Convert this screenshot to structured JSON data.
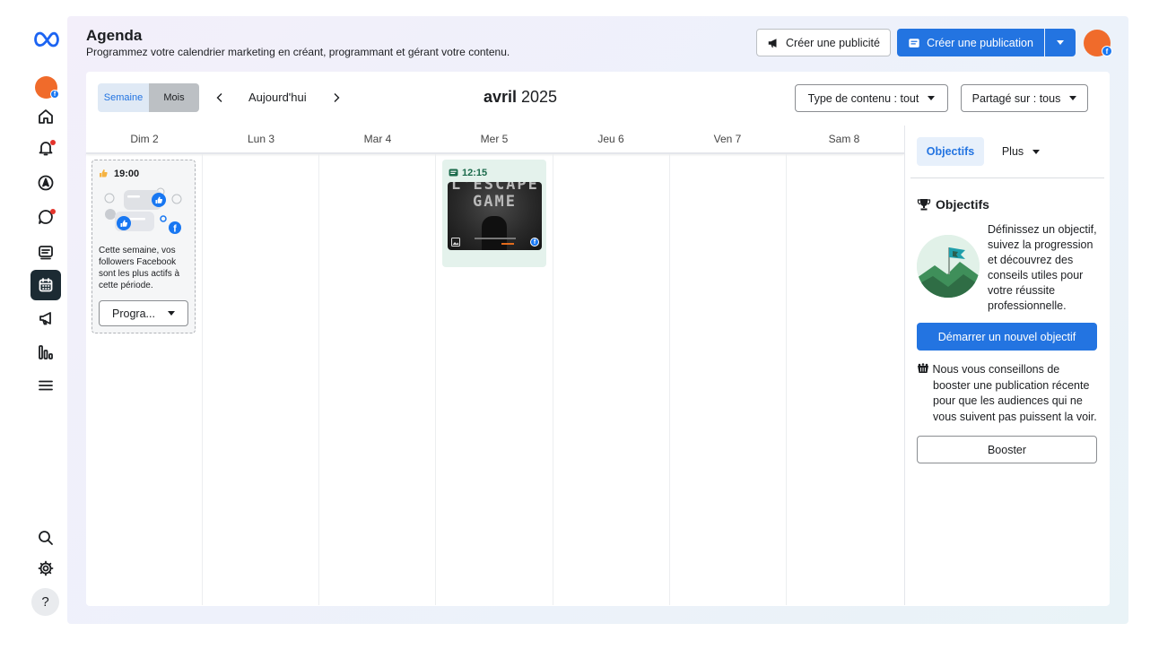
{
  "header": {
    "title": "Agenda",
    "subtitle": "Programmez votre calendrier marketing en créant, programmant et gérant votre contenu.",
    "create_ad": "Créer une publicité",
    "create_post": "Créer une publication"
  },
  "sidebar": {
    "items": [
      {
        "name": "home",
        "icon": "home-icon"
      },
      {
        "name": "notifications",
        "icon": "bell-icon"
      },
      {
        "name": "compass",
        "icon": "compass-icon"
      },
      {
        "name": "messages",
        "icon": "chat-bubble-icon"
      },
      {
        "name": "content",
        "icon": "content-icon"
      },
      {
        "name": "planner",
        "icon": "calendar-icon",
        "active": true
      },
      {
        "name": "ads",
        "icon": "megaphone-icon"
      },
      {
        "name": "insights",
        "icon": "bar-chart-icon"
      },
      {
        "name": "menu",
        "icon": "hamburger-icon"
      },
      {
        "name": "search",
        "icon": "search-icon"
      },
      {
        "name": "settings",
        "icon": "gear-icon"
      },
      {
        "name": "help",
        "label": "?"
      }
    ]
  },
  "toolbar": {
    "week": "Semaine",
    "month": "Mois",
    "today": "Aujourd'hui",
    "month_name": "avril",
    "year": "2025",
    "content_type": "Type de contenu : tout",
    "shared_on": "Partagé sur : tous"
  },
  "days": [
    "Dim 2",
    "Lun 3",
    "Mar 4",
    "Mer 5",
    "Jeu 6",
    "Ven 7",
    "Sam 8"
  ],
  "suggestion": {
    "time": "19:00",
    "text": "Cette semaine, vos followers Facebook sont les plus actifs à cette période.",
    "button": "Progra..."
  },
  "post": {
    "time": "12:15",
    "image_text": "L'ESCAPE GAME"
  },
  "right_panel": {
    "tab_objectives": "Objectifs",
    "tab_more": "Plus",
    "objectives_title": "Objectifs",
    "objectives_desc": "Définissez un objectif, suivez la progression et découvrez des conseils utiles pour votre réussite professionnelle.",
    "start_button": "Démarrer un nouvel objectif",
    "boost_line1": "Nous vous conseillons de",
    "boost_rest": "booster une publication récente pour que les audiences qui ne vous suivent pas puissent la voir.",
    "boost_button": "Booster"
  },
  "colors": {
    "accent": "#2374e1",
    "avatar": "#f06b2b",
    "post_bg": "#e4f2ec",
    "sidebar_active": "#1c2b33"
  }
}
